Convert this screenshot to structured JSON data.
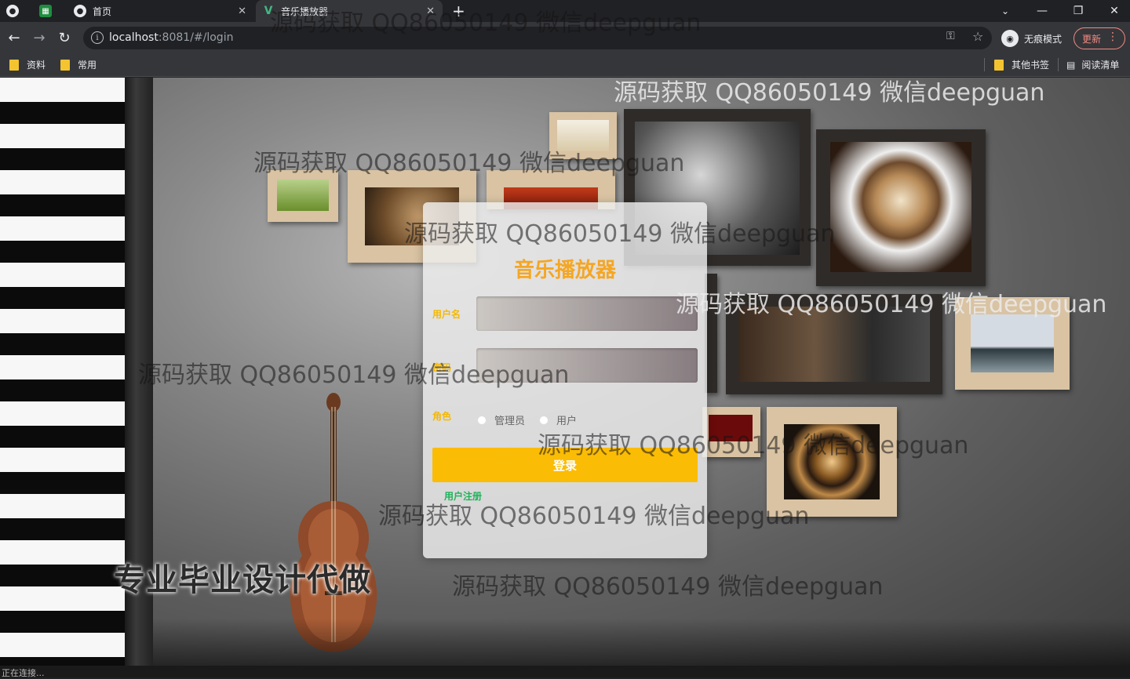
{
  "browser": {
    "tabs": [
      {
        "label": "",
        "icon": "globe-icon"
      },
      {
        "label": "",
        "icon": "spreadsheet-icon"
      },
      {
        "label": "首页",
        "icon": "globe-icon"
      },
      {
        "label": "音乐播放器",
        "icon": "vue-icon"
      }
    ],
    "url_host": "localhost",
    "url_rest": ":8081/#/login",
    "incognito_label": "无痕模式",
    "update_label": "更新",
    "bookmarks": [
      "资料",
      "常用"
    ],
    "bookmarks_right": [
      "其他书签",
      "阅读清单"
    ]
  },
  "login": {
    "title": "音乐播放器",
    "username_label": "用户名",
    "password_label": "密码",
    "role_label": "角色",
    "roles": [
      "管理员",
      "用户"
    ],
    "submit_label": "登录",
    "register_label": "用户注册"
  },
  "watermark": "源码获取 QQ86050149 微信deepguan",
  "ad_text": "专业毕业设计代做",
  "status_text": "正在连接..."
}
